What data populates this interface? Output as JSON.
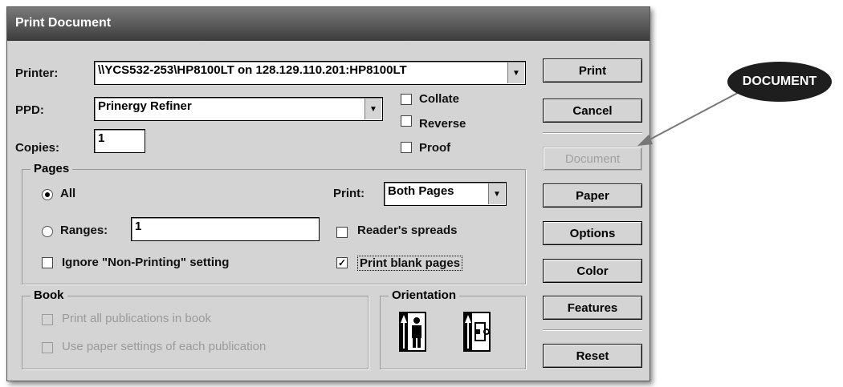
{
  "dialog": {
    "title": "Print Document",
    "printer": {
      "label": "Printer:",
      "value": "\\\\YCS532-253\\HP8100LT on 128.129.110.201:HP8100LT"
    },
    "ppd": {
      "label": "PPD:",
      "value": "Prinergy Refiner"
    },
    "copies": {
      "label": "Copies:",
      "value": "1"
    },
    "checks": {
      "collate": "Collate",
      "reverse": "Reverse",
      "proof": "Proof"
    },
    "pages": {
      "title": "Pages",
      "all": "All",
      "ranges": "Ranges:",
      "ranges_value": "1",
      "print_label": "Print:",
      "print_value": "Both Pages",
      "readers_spreads": "Reader's spreads",
      "ignore_non_printing": "Ignore \"Non-Printing\" setting",
      "print_blank_pages": "Print blank pages"
    },
    "book": {
      "title": "Book",
      "print_all": "Print all publications in book",
      "use_paper": "Use paper settings of each publication"
    },
    "orientation": {
      "title": "Orientation"
    },
    "buttons": {
      "print": "Print",
      "cancel": "Cancel",
      "document": "Document",
      "paper": "Paper",
      "options": "Options",
      "color": "Color",
      "features": "Features",
      "reset": "Reset"
    }
  },
  "callout": {
    "label": "DOCUMENT"
  }
}
